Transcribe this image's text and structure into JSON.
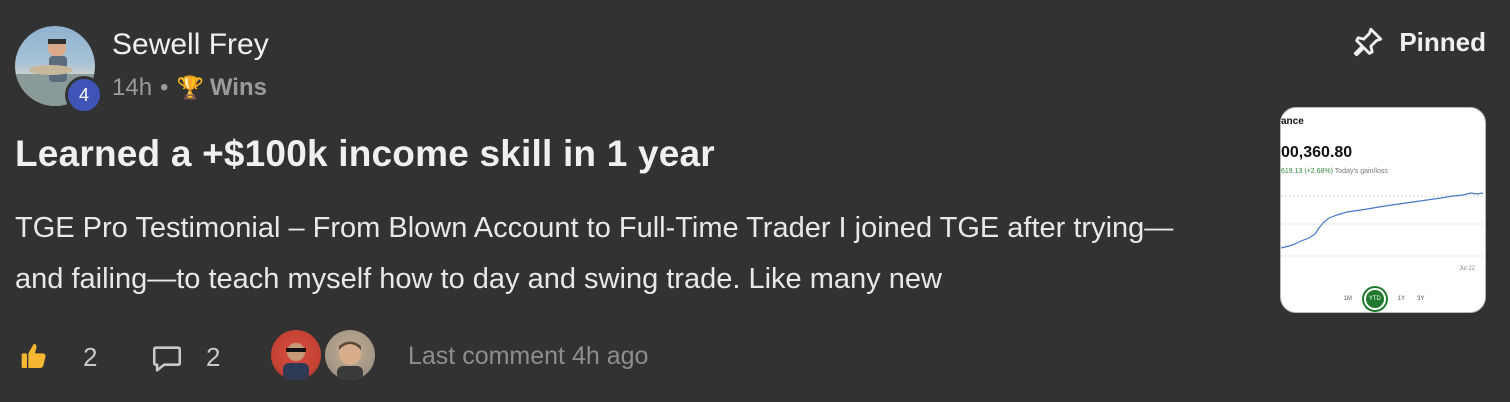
{
  "post": {
    "author": "Sewell Frey",
    "level": "4",
    "time": "14h",
    "separator": "•",
    "category_icon": "🏆",
    "category": "Wins",
    "pinned_label": "Pinned",
    "title": "Learned a +$100k income skill in 1 year",
    "body": "TGE Pro Testimonial – From Blown Account to Full-Time Trader I joined TGE after trying—and failing—to teach myself how to day and swing trade. Like many new"
  },
  "thumbnail": {
    "header": "ance",
    "value": "00,360.80",
    "gain": "619.13 (+2.68%)",
    "gain_label": "Today's gain/loss",
    "date": "Jul 22",
    "ranges": [
      "1M",
      "YTD",
      "1Y",
      "3Y"
    ],
    "selected_range": "YTD",
    "line_color": "#4a78c9"
  },
  "footer": {
    "like_count": "2",
    "comment_count": "2",
    "last_comment": "Last comment 4h ago"
  },
  "colors": {
    "background": "#323232",
    "level_badge": "#3e55b7",
    "like_icon": "#f5b731"
  }
}
